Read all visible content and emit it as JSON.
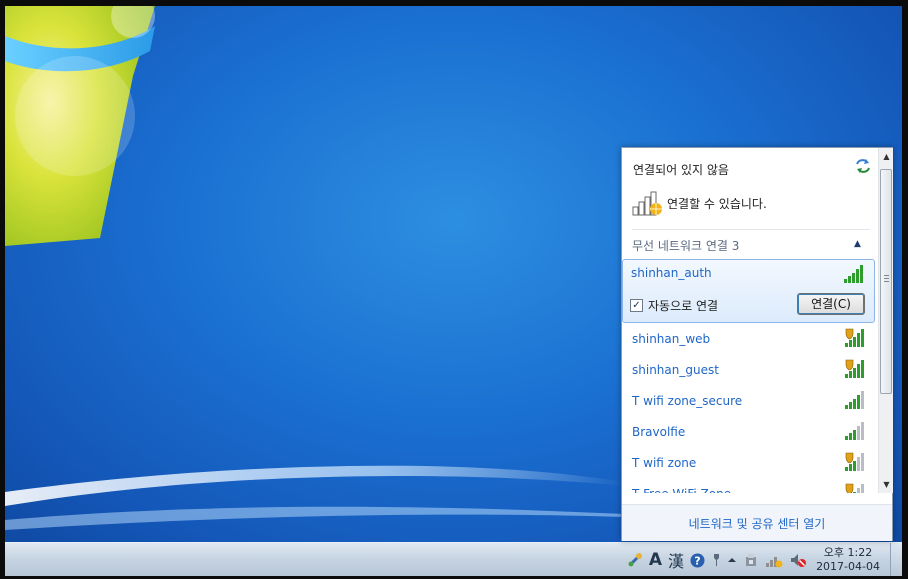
{
  "flyout": {
    "status_title": "연결되어 있지 않음",
    "available_text": "연결할 수 있습니다.",
    "group_title": "무선 네트워크 연결 3",
    "selected_network": {
      "ssid": "shinhan_auth",
      "auto_connect_label": "자동으로 연결",
      "auto_connect_checked": true,
      "connect_button": "연결(C)"
    },
    "networks": [
      {
        "ssid": "shinhan_web",
        "secured": true,
        "strength": 5
      },
      {
        "ssid": "shinhan_guest",
        "secured": true,
        "strength": 5
      },
      {
        "ssid": "T wifi zone_secure",
        "secured": false,
        "strength": 4
      },
      {
        "ssid": "Bravolfie",
        "secured": false,
        "strength": 3
      },
      {
        "ssid": "T wifi zone",
        "secured": true,
        "strength": 3
      },
      {
        "ssid": "T Free WiFi Zone",
        "secured": true,
        "strength": 3
      }
    ],
    "footer_link": "네트워크 및 공유 센터 열기"
  },
  "taskbar": {
    "ime_lang": "A",
    "ime_hanja": "漢",
    "clock_time": "오후 1:22",
    "clock_date": "2017-04-04"
  },
  "colors": {
    "link": "#1f66c7",
    "signal_green": "#2e9d2e",
    "shield_yellow": "#e0a21a"
  }
}
